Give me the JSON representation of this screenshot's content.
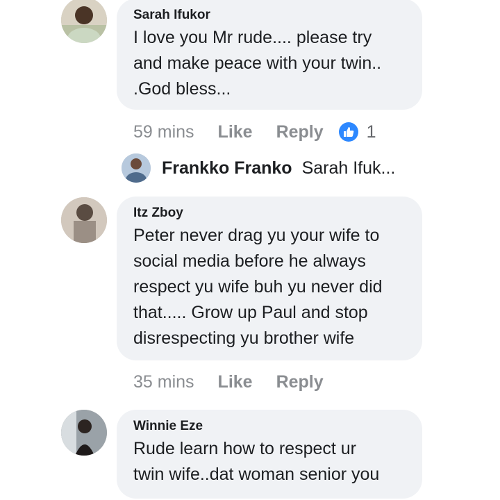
{
  "comments": [
    {
      "author": "Sarah Ifukor",
      "lines": [
        "I love you Mr rude.... please try",
        "and make peace with your twin..",
        ".God bless..."
      ],
      "time": "59 mins",
      "like_label": "Like",
      "reply_label": "Reply",
      "reaction_count": "1"
    },
    {
      "author": "Itz Zboy",
      "lines": [
        "Peter never drag yu your wife to",
        "social media before he always",
        "respect yu wife buh yu never did",
        "that..... Grow up Paul and stop",
        "disrespecting yu brother wife"
      ],
      "time": "35 mins",
      "like_label": "Like",
      "reply_label": "Reply"
    },
    {
      "author": "Winnie Eze",
      "lines": [
        "Rude learn how to respect ur",
        "twin wife..dat woman senior you"
      ]
    }
  ],
  "reply_preview": {
    "author": "Frankko Franko",
    "text": "Sarah Ifuk..."
  },
  "icons": {
    "like": "thumbs-up-icon"
  },
  "colors": {
    "bubble": "#f0f2f5",
    "meta": "#8a8d91",
    "like_badge": "#2d88ff"
  }
}
